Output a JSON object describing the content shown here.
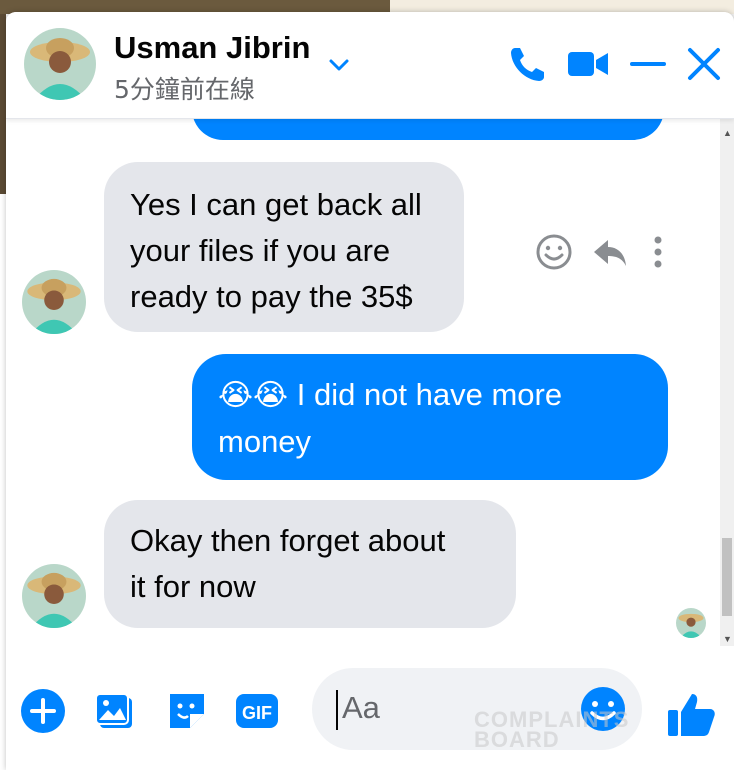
{
  "header": {
    "name": "Usman Jibrin",
    "status": "5分鐘前在線"
  },
  "messages": [
    {
      "direction": "outgoing",
      "text": "",
      "partial": true
    },
    {
      "direction": "incoming",
      "lines": [
        "Yes I can get back all",
        "your files if you are",
        "ready to pay the 35$"
      ]
    },
    {
      "direction": "outgoing",
      "emoji": "😭😭",
      "lines": [
        "I did not have more",
        "money"
      ]
    },
    {
      "direction": "incoming",
      "lines": [
        "Okay then forget about",
        "it for now"
      ]
    }
  ],
  "message_actions": [
    "react-icon",
    "reply-icon",
    "more-icon"
  ],
  "composer": {
    "placeholder": "Aa",
    "gif_label": "GIF"
  },
  "watermark": {
    "line1": "COMPLAINTS",
    "line2": "BOARD"
  },
  "colors": {
    "accent": "#0084ff",
    "incoming_bubble": "#e4e6eb",
    "outgoing_bubble": "#0084ff"
  }
}
